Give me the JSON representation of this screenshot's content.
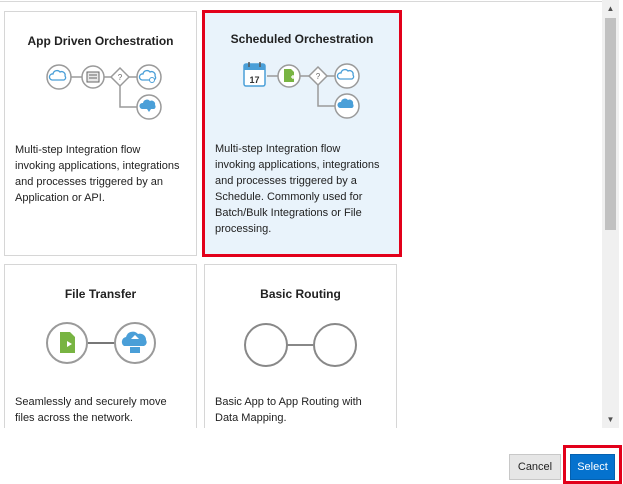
{
  "cards": [
    {
      "title": "App Driven Orchestration",
      "description_lines": [
        "Multi-step Integration flow",
        "invoking applications, integrations",
        "and processes triggered by an",
        "Application or API."
      ],
      "selected": false
    },
    {
      "title": "Scheduled Orchestration",
      "description_lines": [
        "Multi-step Integration flow",
        "invoking applications, integrations",
        "and processes triggered by a",
        "Schedule. Commonly used for",
        "Batch/Bulk Integrations or File",
        "processing."
      ],
      "selected": true,
      "calendar_day": "17"
    },
    {
      "title": "File Transfer",
      "description_lines": [
        "Seamlessly and securely move",
        "files across the network."
      ],
      "selected": false
    },
    {
      "title": "Basic Routing",
      "description_lines": [
        "Basic App to App Routing with",
        "Data Mapping."
      ],
      "selected": false
    }
  ],
  "diagram_glyphs": {
    "decision": "?"
  },
  "buttons": {
    "cancel": "Cancel",
    "select": "Select"
  },
  "colors": {
    "accent": "#0572ce",
    "highlight": "#e2001a",
    "selected_bg": "#e9f3fb",
    "icon_blue": "#4a9fd8",
    "icon_green": "#78b442"
  }
}
